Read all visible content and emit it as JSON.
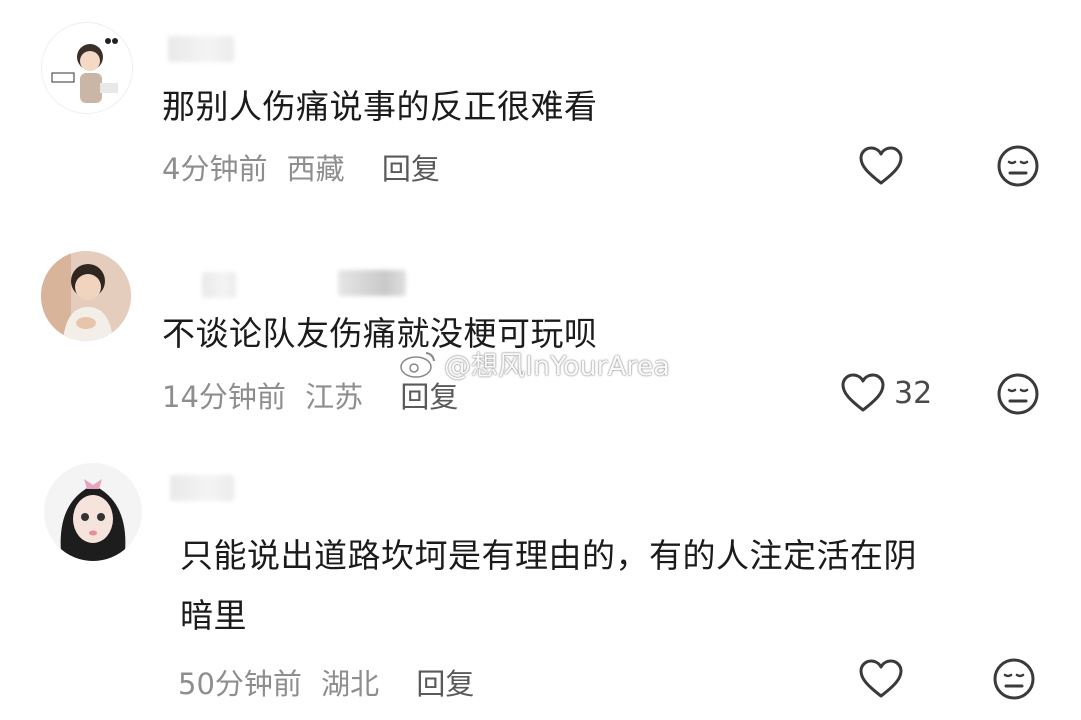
{
  "comments": [
    {
      "text": "那别人伤痛说事的反正很难看",
      "time": "4分钟前",
      "location": "西藏",
      "reply": "回复",
      "likes": ""
    },
    {
      "text": "不谈论队友伤痛就没梗可玩呗",
      "time": "14分钟前",
      "location": "江苏",
      "reply": "回复",
      "likes": "32"
    },
    {
      "text_line1": "只能说出道路坎坷是有理由的，有的人注定活在阴",
      "text_line2": "暗里",
      "time": "50分钟前",
      "location": "湖北",
      "reply": "回复",
      "likes": ""
    }
  ],
  "watermark": "@想风InYourArea",
  "icons": {
    "like": "heart-outline-icon",
    "dislike": "neutral-face-icon",
    "watermark": "weibo-logo-icon"
  },
  "colors": {
    "text": "#1b1b1b",
    "meta": "#8e8e8e",
    "icon": "#3a3a3a"
  }
}
